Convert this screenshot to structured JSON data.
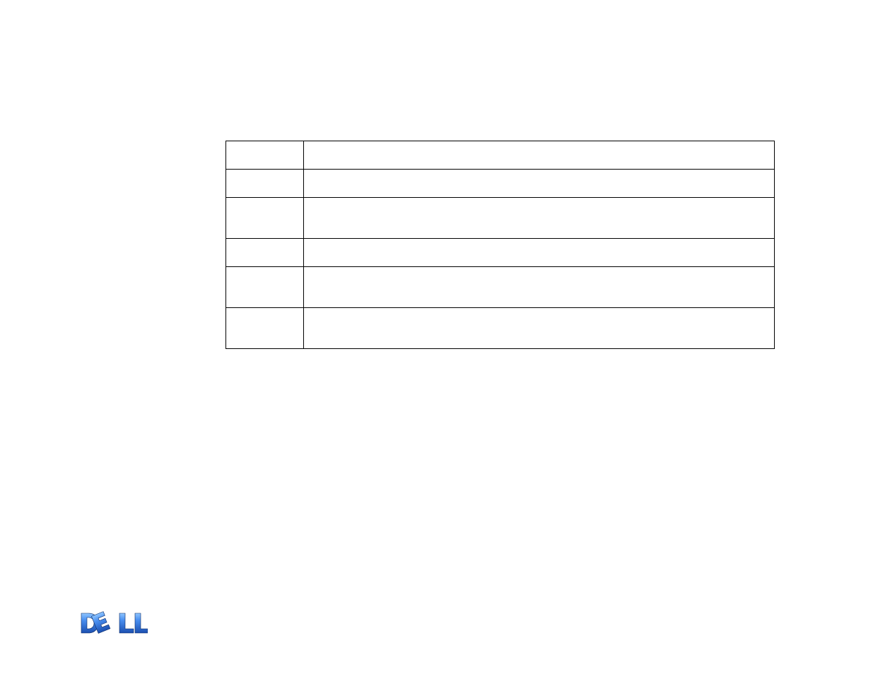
{
  "table": {
    "rows": [
      {
        "left": "",
        "right": ""
      },
      {
        "left": "",
        "right": ""
      },
      {
        "left": "",
        "right": ""
      },
      {
        "left": "",
        "right": ""
      },
      {
        "left": "",
        "right": ""
      },
      {
        "left": "",
        "right": ""
      }
    ]
  },
  "logo": {
    "name": "DELL"
  }
}
